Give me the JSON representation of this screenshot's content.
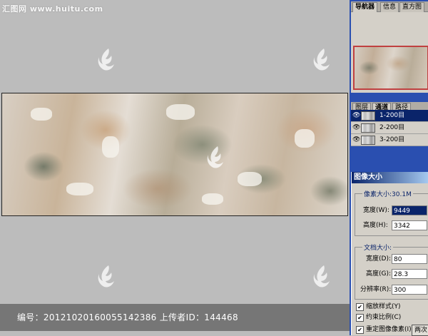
{
  "watermark": {
    "site": "汇图网 www.huitu.com",
    "logo_icon": "huitu-logo-icon"
  },
  "footer": {
    "text": "编号：20121020160055142386 上传者ID：144468"
  },
  "navigator_panel": {
    "tabs": [
      {
        "label": "导航器"
      },
      {
        "label": "信息"
      },
      {
        "label": "直方图"
      }
    ]
  },
  "layers_panel": {
    "tabs": [
      {
        "label": "图层"
      },
      {
        "label": "通道"
      },
      {
        "label": "路径"
      }
    ],
    "channels": [
      {
        "label": "1-200目",
        "selected": true
      },
      {
        "label": "2-200目",
        "selected": false
      },
      {
        "label": "3-200目",
        "selected": false
      }
    ]
  },
  "image_size_dialog": {
    "title": "图像大小",
    "pixel_dimensions": {
      "title": "像素大小:30.1M",
      "width_label": "宽度(W):",
      "width_value": "9449",
      "height_label": "高度(H):",
      "height_value": "3342"
    },
    "document_size": {
      "title": "文档大小:",
      "width_label": "宽度(D):",
      "width_value": "80",
      "height_label": "高度(G):",
      "height_value": "28.3",
      "resolution_label": "分辨率(R):",
      "resolution_value": "300"
    },
    "checkboxes": [
      {
        "label": "缩放样式(Y)",
        "checked": true
      },
      {
        "label": "约束比例(C)",
        "checked": true
      },
      {
        "label": "重定图像像素(I):",
        "checked": true
      }
    ],
    "resample_value": "两次"
  },
  "colors": {
    "panel_bg": "#d4d0c8",
    "selection": "#0a246a",
    "workspace": "#bcbcbc"
  }
}
